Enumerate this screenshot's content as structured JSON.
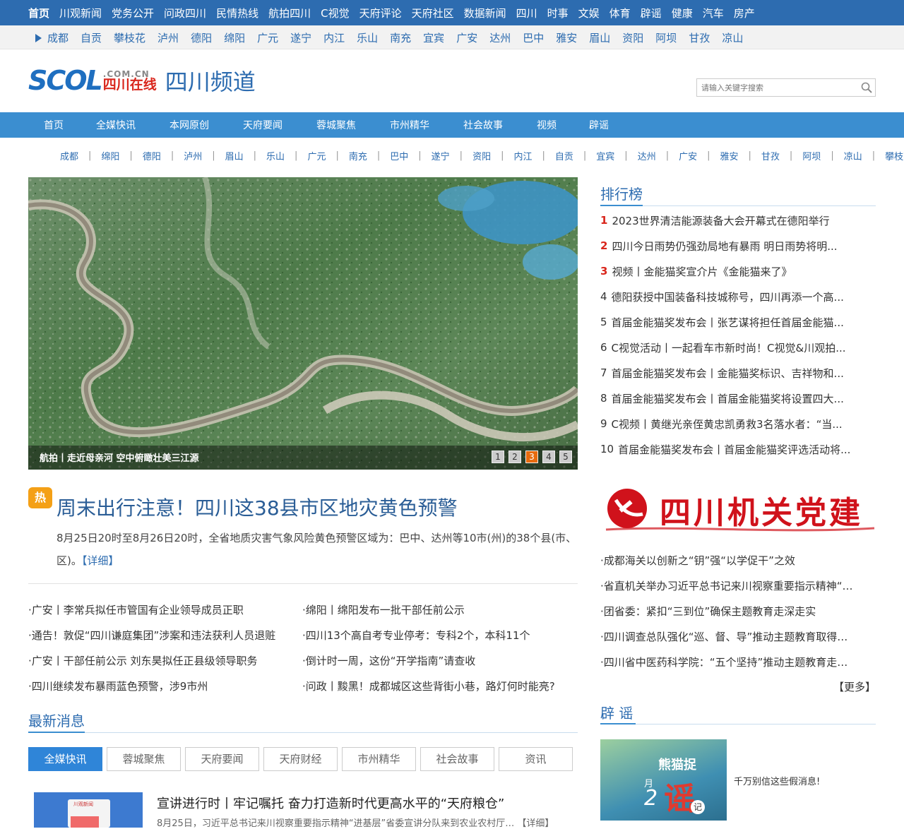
{
  "topnav": [
    "首页",
    "川观新闻",
    "党务公开",
    "问政四川",
    "民情热线",
    "航拍四川",
    "C视觉",
    "天府评论",
    "天府社区",
    "数据新闻",
    "四川",
    "时事",
    "文娱",
    "体育",
    "辟谣",
    "健康",
    "汽车",
    "房产"
  ],
  "citybar": [
    "成都",
    "自贡",
    "攀枝花",
    "泸州",
    "德阳",
    "绵阳",
    "广元",
    "遂宁",
    "内江",
    "乐山",
    "南充",
    "宜宾",
    "广安",
    "达州",
    "巴中",
    "雅安",
    "眉山",
    "资阳",
    "阿坝",
    "甘孜",
    "凉山"
  ],
  "logo": {
    "scol": "SCOL",
    "comcn": ".COM.CN",
    "sczx": "四川在线",
    "channel": "四川频道"
  },
  "search": {
    "placeholder": "请输入关键字搜索"
  },
  "mainnav": [
    "首页",
    "全媒快讯",
    "本网原创",
    "天府要闻",
    "蓉城聚焦",
    "市州精华",
    "社会故事",
    "视频",
    "辟谣"
  ],
  "subcity": [
    "成都",
    "绵阳",
    "德阳",
    "泸州",
    "眉山",
    "乐山",
    "广元",
    "南充",
    "巴中",
    "遂宁",
    "资阳",
    "内江",
    "自贡",
    "宜宾",
    "达州",
    "广安",
    "雅安",
    "甘孜",
    "阿坝",
    "凉山",
    "攀枝花"
  ],
  "subcity_sep": "|",
  "slider": {
    "caption": "航拍丨走近母亲河 空中俯瞰壮美三江源",
    "pages": [
      "1",
      "2",
      "3",
      "4",
      "5"
    ],
    "active_page": "3"
  },
  "headline": {
    "badge": "热",
    "title": "周末出行注意！四川这38县市区地灾黄色预警",
    "summary": "8月25日20时至8月26日20时，全省地质灾害气象风险黄色预警区域为：巴中、达州等10市(州)的38个县(市、区)。",
    "detail": "【详细】"
  },
  "newsgrid": [
    [
      "·广安丨李常兵拟任市管国有企业领导成员正职",
      "·绵阳丨绵阳发布一批干部任前公示"
    ],
    [
      "·通告！敦促“四川谦庭集团”涉案和违法获利人员退赃",
      "·四川13个高自考专业停考：专科2个，本科11个"
    ],
    [
      "·广安丨干部任前公示 刘东昊拟任正县级领导职务",
      "·倒计时一周，这份“开学指南”请查收"
    ],
    [
      "·四川继续发布暴雨蓝色预警，涉9市州",
      "·问政丨黢黑！成都城区这些背街小巷，路灯何时能亮?"
    ]
  ],
  "latest": {
    "title": "最新消息",
    "tabs": [
      "全媒快讯",
      "蓉城聚焦",
      "天府要闻",
      "天府财经",
      "市州精华",
      "社会故事",
      "资讯"
    ],
    "item_title": "宣讲进行时丨牢记嘱托 奋力打造新时代更高水平的“天府粮仓”",
    "item_summary": "8月25日，习近平总书记来川视察重要指示精神“进基层”省委宣讲分队来到农业农村厅… 【详细】",
    "thumb_label": "川观新闻"
  },
  "ranking": {
    "title": "排行榜",
    "items": [
      {
        "n": "1",
        "t": "2023世界清洁能源装备大会开幕式在德阳举行"
      },
      {
        "n": "2",
        "t": "四川今日雨势仍强劲局地有暴雨 明日雨势将明..."
      },
      {
        "n": "3",
        "t": "视频丨金能猫奖宣介片《金能猫来了》"
      },
      {
        "n": "4",
        "t": "德阳获授中国装备科技城称号，四川再添一个高..."
      },
      {
        "n": "5",
        "t": "首届金能猫奖发布会丨张艺谋将担任首届金能猫..."
      },
      {
        "n": "6",
        "t": "C视觉活动丨一起看车市新时尚！C视觉&川观拍..."
      },
      {
        "n": "7",
        "t": "首届金能猫奖发布会丨金能猫奖标识、吉祥物和..."
      },
      {
        "n": "8",
        "t": "首届金能猫奖发布会丨首届金能猫奖将设置四大..."
      },
      {
        "n": "9",
        "t": "C视频丨黄继光亲侄黄忠凯勇救3名落水者：“当..."
      },
      {
        "n": "10",
        "t": "首届金能猫奖发布会丨首届金能猫奖评选活动将..."
      }
    ]
  },
  "party": {
    "banner": "四川机关党建",
    "items": [
      "·成都海关以创新之“钥”强“以学促干”之效",
      "·省直机关举办习近平总书记来川视察重要指示精神“…",
      "·团省委：紧扣“三到位”确保主题教育走深走实",
      "·四川调查总队强化“巡、督、导”推动主题教育取得…",
      "·四川省中医药科学院：“五个坚持”推动主题教育走…"
    ],
    "more": "【更多】"
  },
  "rumor": {
    "title": "辟 谣",
    "img_line1": "熊猫捉",
    "img_line2": "谣",
    "img_month": "2",
    "img_month_label": "月",
    "img_ji": "记",
    "text": "千万别信这些假消息!"
  }
}
